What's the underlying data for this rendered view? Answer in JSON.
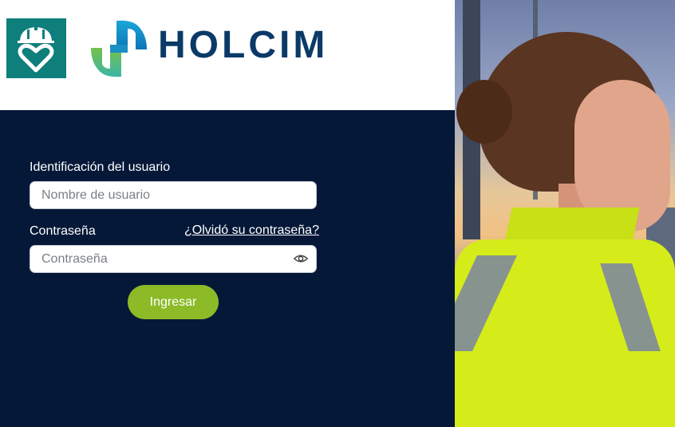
{
  "header": {
    "brand_name": "HOLCIM",
    "app_icon": "safety-helmet-heart-icon",
    "brand_logo": "holcim-h-logo-icon"
  },
  "login": {
    "user_label": "Identificación del usuario",
    "user_placeholder": "Nombre de usuario",
    "user_value": "",
    "password_label": "Contraseña",
    "forgot_link": "¿Olvidó su contraseña?",
    "password_placeholder": "Contraseña",
    "password_value": "",
    "show_password_icon": "eye-icon",
    "submit_label": "Ingresar"
  },
  "colors": {
    "header_bg": "#ffffff",
    "panel_bg": "#061838",
    "app_icon_bg": "#0f7f7c",
    "brand_text": "#0b3a67",
    "submit_bg": "#8dbb27"
  },
  "photo": {
    "subject": "worker-in-hi-vis-shirt-photo"
  }
}
